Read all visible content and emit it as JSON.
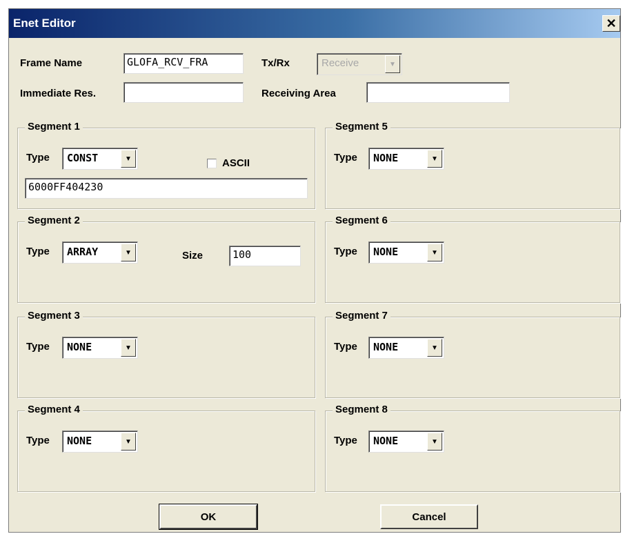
{
  "window": {
    "title": "Enet Editor",
    "close_glyph": "✕"
  },
  "form": {
    "frame_name_label": "Frame Name",
    "frame_name_value": "GLOFA_RCV_FRA",
    "txrx_label": "Tx/Rx",
    "txrx_value": "Receive",
    "immediate_label": "Immediate Res.",
    "immediate_value": "",
    "receiving_area_label": "Receiving Area",
    "receiving_area_value": ""
  },
  "segments": {
    "type_label": "Type",
    "s1": {
      "title": "Segment 1",
      "type": "CONST",
      "ascii_label": "ASCII",
      "ascii_checked": false,
      "value": "6000FF404230"
    },
    "s2": {
      "title": "Segment 2",
      "type": "ARRAY",
      "size_label": "Size",
      "size_value": "100"
    },
    "s3": {
      "title": "Segment 3",
      "type": "NONE"
    },
    "s4": {
      "title": "Segment 4",
      "type": "NONE"
    },
    "s5": {
      "title": "Segment 5",
      "type": "NONE"
    },
    "s6": {
      "title": "Segment 6",
      "type": "NONE"
    },
    "s7": {
      "title": "Segment 7",
      "type": "NONE"
    },
    "s8": {
      "title": "Segment 8",
      "type": "NONE"
    }
  },
  "buttons": {
    "ok": "OK",
    "cancel": "Cancel"
  },
  "icons": {
    "dropdown": "chevron-down-icon",
    "close": "close-icon"
  },
  "colors": {
    "dialog_bg": "#ECE9D8",
    "title_start": "#0a246a",
    "title_end": "#a6caf0"
  }
}
